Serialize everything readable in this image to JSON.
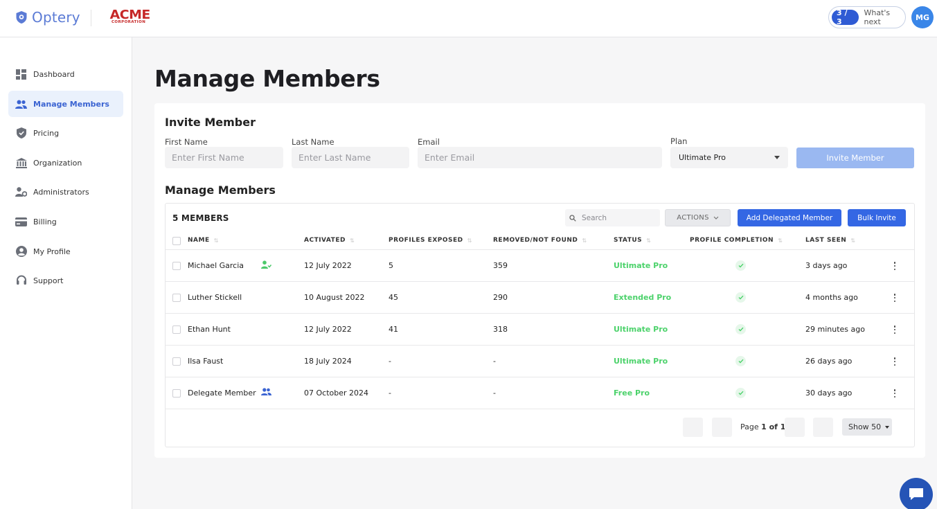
{
  "brand": {
    "name": "Optery",
    "partner_name": "ACME",
    "partner_sub": "CORPORATION",
    "accent": "#3467e4",
    "logo_color": "#5b7bd5"
  },
  "header": {
    "progress": "3 / 3",
    "whats_next": "What's next",
    "avatar_initials": "MG"
  },
  "sidebar": {
    "items": [
      {
        "label": "Dashboard",
        "icon": "dashboard-icon"
      },
      {
        "label": "Manage Members",
        "icon": "members-icon",
        "active": true
      },
      {
        "label": "Pricing",
        "icon": "shield-icon"
      },
      {
        "label": "Organization",
        "icon": "bank-icon"
      },
      {
        "label": "Administrators",
        "icon": "admin-gear-icon"
      },
      {
        "label": "Billing",
        "icon": "card-icon"
      },
      {
        "label": "My Profile",
        "icon": "profile-icon"
      },
      {
        "label": "Support",
        "icon": "headset-icon"
      }
    ]
  },
  "page": {
    "title": "Manage Members"
  },
  "invite": {
    "title": "Invite Member",
    "first_name": {
      "label": "First Name",
      "placeholder": "Enter First Name",
      "value": ""
    },
    "last_name": {
      "label": "Last Name",
      "placeholder": "Enter Last Name",
      "value": ""
    },
    "email": {
      "label": "Email",
      "placeholder": "Enter Email",
      "value": ""
    },
    "plan": {
      "label": "Plan",
      "selected": "Ultimate Pro"
    },
    "button": "Invite Member"
  },
  "members": {
    "title": "Manage Members",
    "count_label": "5 MEMBERS",
    "search_placeholder": "Search",
    "actions_label": "ACTIONS",
    "add_delegated_label": "Add Delegated Member",
    "bulk_invite_label": "Bulk Invite",
    "columns": [
      "NAME",
      "ACTIVATED",
      "PROFILES EXPOSED",
      "REMOVED/NOT FOUND",
      "STATUS",
      "PROFILE COMPLETION",
      "LAST SEEN"
    ],
    "rows": [
      {
        "name": "Michael Garcia",
        "activated": "12 July 2022",
        "exposed": "5",
        "removed": "359",
        "status": "Ultimate Pro",
        "last_seen": "3 days ago",
        "icon": "user-check-icon"
      },
      {
        "name": "Luther Stickell",
        "activated": "10 August 2022",
        "exposed": "45",
        "removed": "290",
        "status": "Extended Pro",
        "last_seen": "4 months ago",
        "icon": ""
      },
      {
        "name": "Ethan Hunt",
        "activated": "12 July 2022",
        "exposed": "41",
        "removed": "318",
        "status": "Ultimate Pro",
        "last_seen": "29 minutes ago",
        "icon": ""
      },
      {
        "name": "Ilsa Faust",
        "activated": "18 July 2024",
        "exposed": "-",
        "removed": "-",
        "status": "Ultimate Pro",
        "last_seen": "26 days ago",
        "icon": ""
      },
      {
        "name": "Delegate Member",
        "activated": "07 October 2024",
        "exposed": "-",
        "removed": "-",
        "status": "Free Pro",
        "last_seen": "30 days ago",
        "icon": "group-icon"
      }
    ],
    "pagination": {
      "page_prefix": "Page ",
      "page_current": "1 of 1",
      "show_label": "Show 50"
    }
  }
}
